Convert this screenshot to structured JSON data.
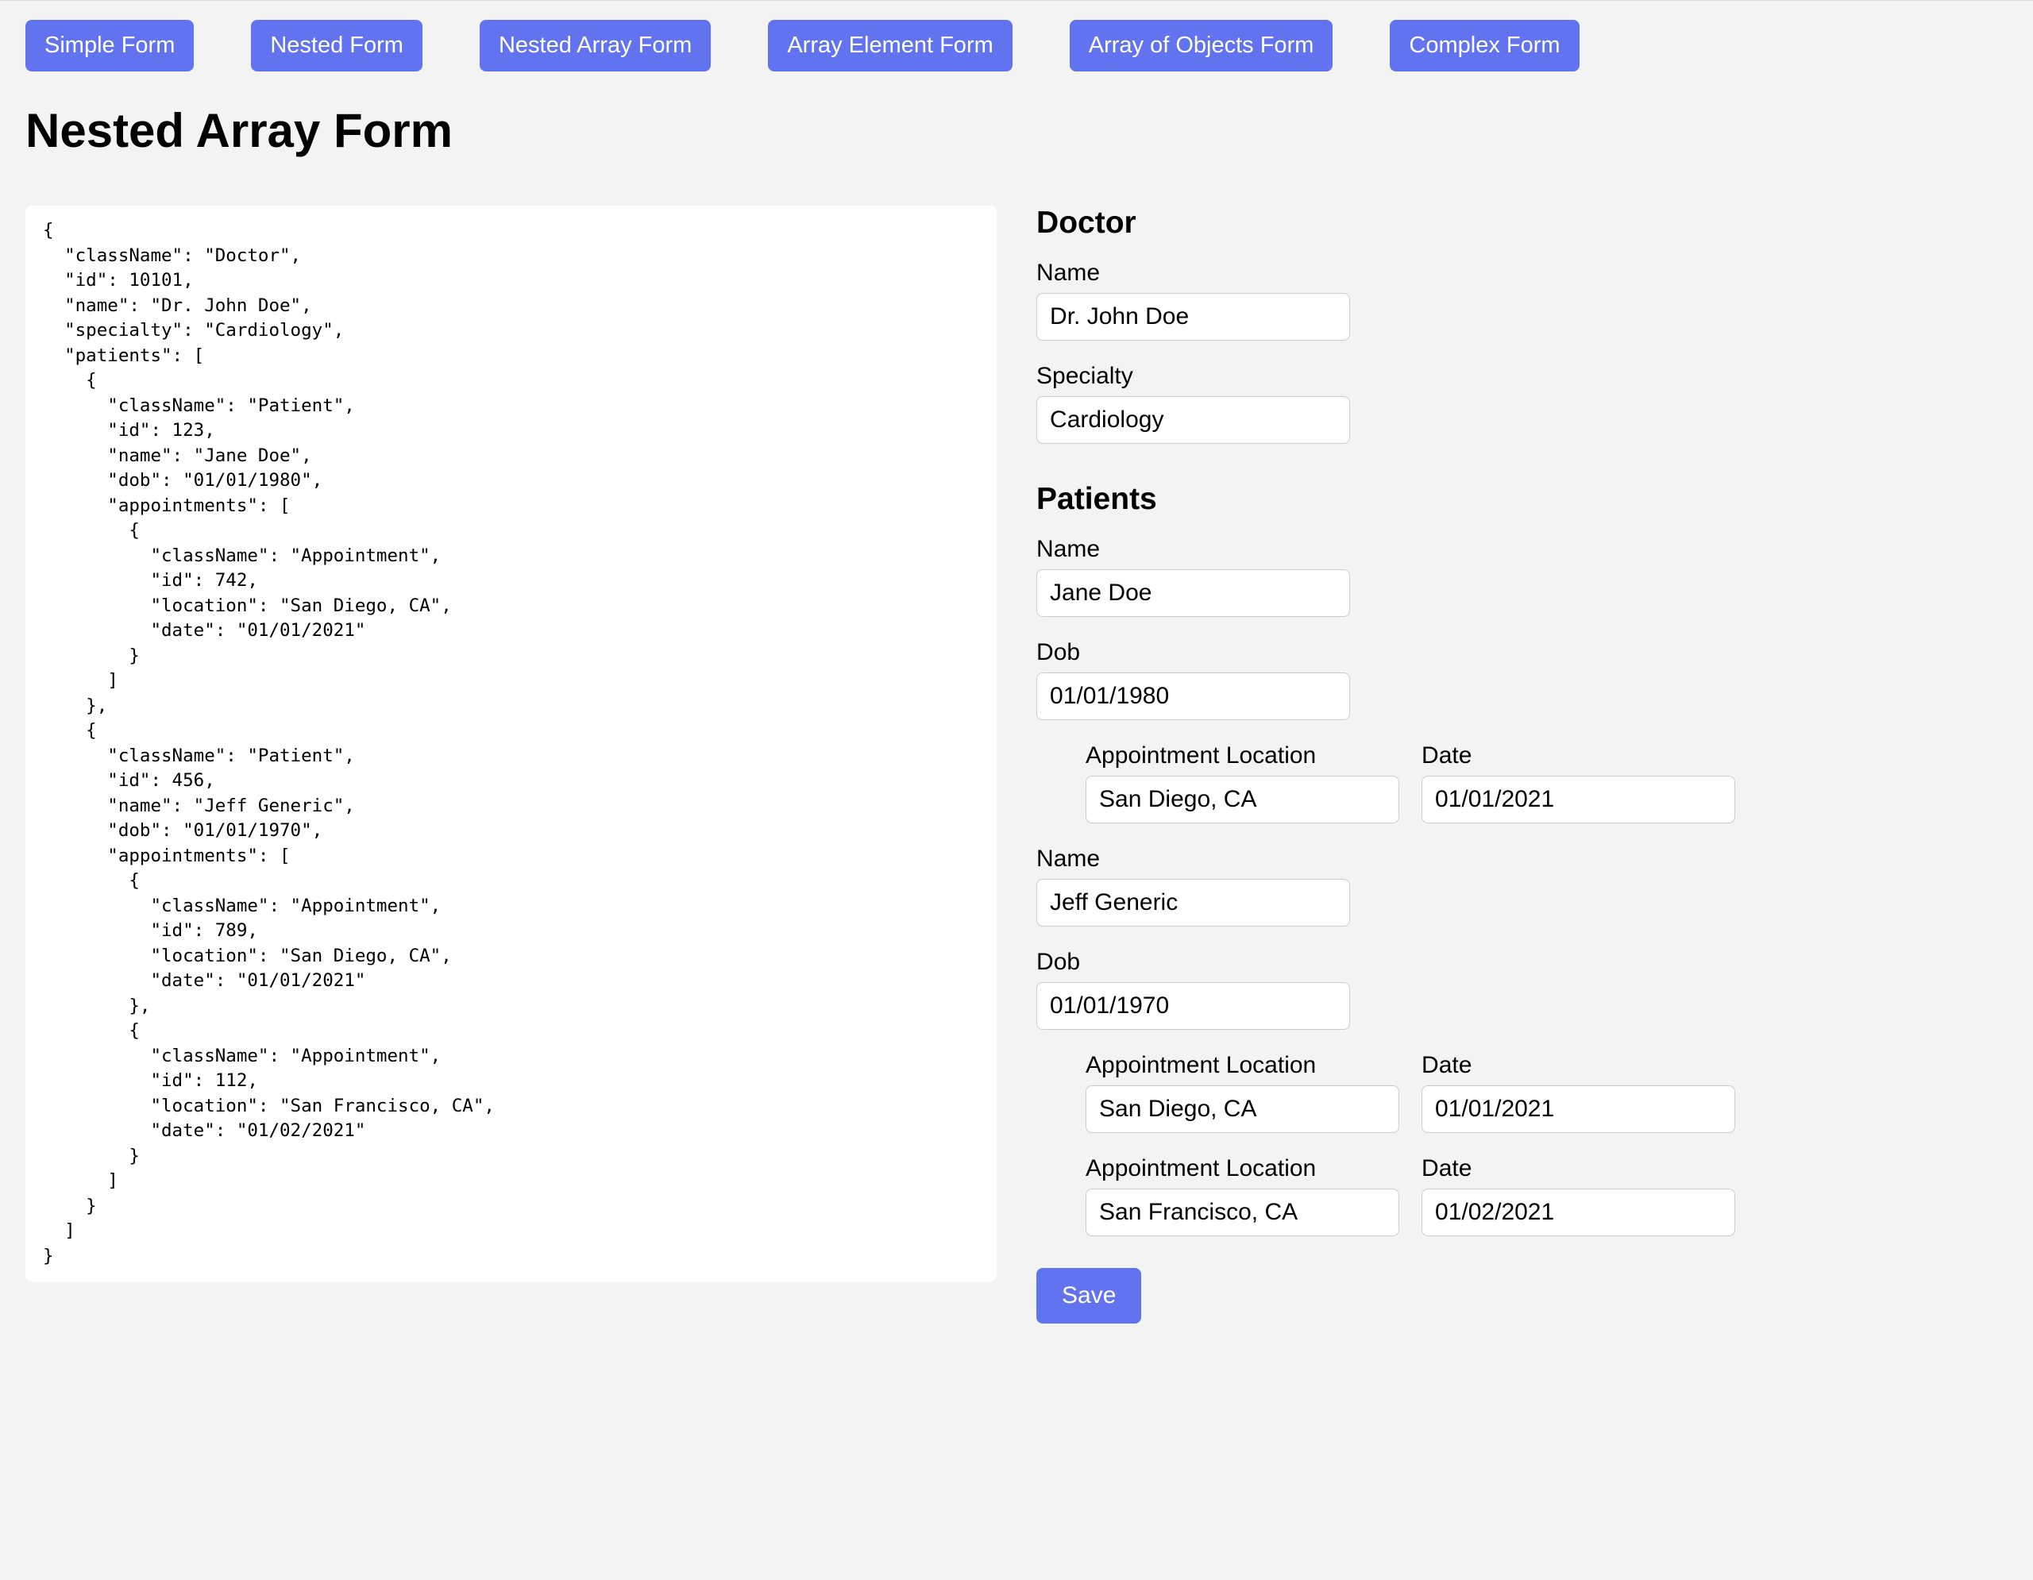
{
  "nav": {
    "tabs": [
      "Simple Form",
      "Nested Form",
      "Nested Array Form",
      "Array Element Form",
      "Array of Objects Form",
      "Complex Form"
    ]
  },
  "page_title": "Nested Array Form",
  "code_json": {
    "className": "Doctor",
    "id": 10101,
    "name": "Dr. John Doe",
    "specialty": "Cardiology",
    "patients": [
      {
        "className": "Patient",
        "id": 123,
        "name": "Jane Doe",
        "dob": "01/01/1980",
        "appointments": [
          {
            "className": "Appointment",
            "id": 742,
            "location": "San Diego, CA",
            "date": "01/01/2021"
          }
        ]
      },
      {
        "className": "Patient",
        "id": 456,
        "name": "Jeff Generic",
        "dob": "01/01/1970",
        "appointments": [
          {
            "className": "Appointment",
            "id": 789,
            "location": "San Diego, CA",
            "date": "01/01/2021"
          },
          {
            "className": "Appointment",
            "id": 112,
            "location": "San Francisco, CA",
            "date": "01/02/2021"
          }
        ]
      }
    ]
  },
  "form": {
    "doctor_heading": "Doctor",
    "name_label": "Name",
    "specialty_label": "Specialty",
    "patients_heading": "Patients",
    "dob_label": "Dob",
    "appt_location_label": "Appointment Location",
    "appt_date_label": "Date",
    "doctor_name": "Dr. John Doe",
    "doctor_specialty": "Cardiology",
    "patients": [
      {
        "name": "Jane Doe",
        "dob": "01/01/1980",
        "appointments": [
          {
            "location": "San Diego, CA",
            "date": "01/01/2021"
          }
        ]
      },
      {
        "name": "Jeff Generic",
        "dob": "01/01/1970",
        "appointments": [
          {
            "location": "San Diego, CA",
            "date": "01/01/2021"
          },
          {
            "location": "San Francisco, CA",
            "date": "01/02/2021"
          }
        ]
      }
    ],
    "save_label": "Save"
  }
}
